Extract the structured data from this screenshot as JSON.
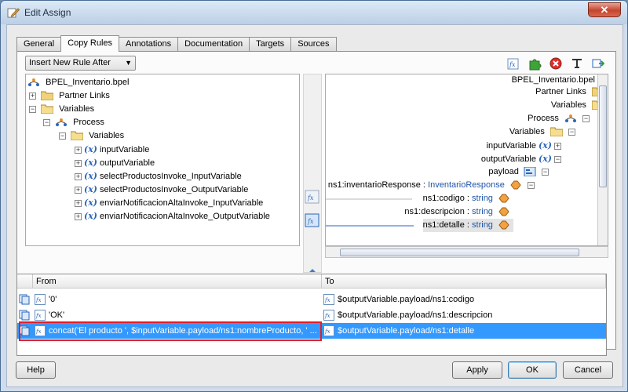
{
  "window": {
    "title": "Edit Assign",
    "close": "✕"
  },
  "tabs": [
    "General",
    "Copy Rules",
    "Annotations",
    "Documentation",
    "Targets",
    "Sources"
  ],
  "rule_mode": {
    "selected": "Insert New Rule After"
  },
  "toolbar_icons": [
    "expression-icon",
    "puzzle-icon",
    "delete-icon",
    "literal-icon",
    "xml-fragment-icon"
  ],
  "source_tree": {
    "root": "BPEL_Inventario.bpel",
    "partner_links": "Partner Links",
    "variables": "Variables",
    "process": "Process",
    "process_variables": "Variables",
    "items": [
      "inputVariable",
      "outputVariable",
      "selectProductosInvoke_InputVariable",
      "selectProductosInvoke_OutputVariable",
      "enviarNotificacionAltaInvoke_InputVariable",
      "enviarNotificacionAltaInvoke_OutputVariable"
    ]
  },
  "target_tree": {
    "root": "BPEL_Inventario.bpel",
    "partner_links": "Partner Links",
    "variables": "Variables",
    "process": "Process",
    "process_variables": "Variables",
    "input_var": "inputVariable",
    "output_var": "outputVariable",
    "payload": "payload",
    "response_name": "ns1:inventarioResponse",
    "response_sep": " : ",
    "response_type": "InventarioResponse",
    "fields": [
      {
        "name": "ns1:codigo",
        "sep": " : ",
        "type": "string"
      },
      {
        "name": "ns1:descripcion",
        "sep": " : ",
        "type": "string"
      },
      {
        "name": "ns1:detalle",
        "sep": " : ",
        "type": "string"
      }
    ]
  },
  "rules": {
    "header_from": "From",
    "header_to": "To",
    "rows": [
      {
        "from": "'0'",
        "to": "$outputVariable.payload/ns1:codigo"
      },
      {
        "from": "'OK'",
        "to": "$outputVariable.payload/ns1:descripcion"
      },
      {
        "from": "concat('El producto ', $inputVariable.payload/ns1:nombreProducto, ' ...",
        "to": "$outputVariable.payload/ns1:detalle"
      }
    ]
  },
  "buttons": {
    "help": "Help",
    "apply": "Apply",
    "ok": "OK",
    "cancel": "Cancel"
  },
  "colors": {
    "accent": "#3399ff",
    "highlight": "#e0202a",
    "type_text": "#1e55a8"
  }
}
